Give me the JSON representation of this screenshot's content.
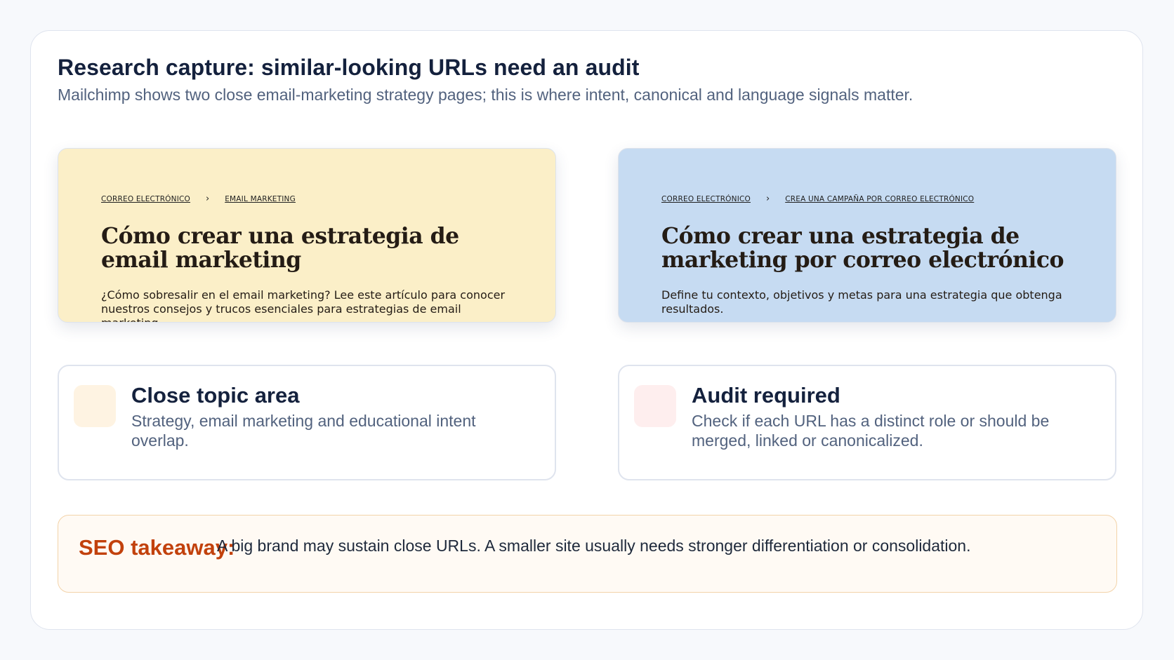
{
  "header": {
    "title": "Research capture: similar-looking URLs need an audit",
    "subtitle": "Mailchimp shows two close email-marketing strategy pages; this is where intent, canonical and language signals matter."
  },
  "screenshots": [
    {
      "crumb_1": "Correo electrónico",
      "separator": "›",
      "crumb_2": "Email marketing",
      "title": "Cómo crear una estrategia de email marketing",
      "description": "¿Cómo sobresalir en el email marketing? Lee este artículo para conocer nuestros consejos y trucos esenciales para estrategias de email marketing",
      "background": "#fbefc8"
    },
    {
      "crumb_1": "Correo electrónico",
      "separator": "›",
      "crumb_2": "Crea una campaña por correo electrónico",
      "title": "Cómo crear una estrategia de marketing por correo electrónico",
      "description": "Define tu contexto, objetivos y metas para una estrategia que obtenga resultados.",
      "background": "#c6dbf2"
    }
  ],
  "cards": [
    {
      "title": "Close topic area",
      "description": "Strategy, email marketing and educational intent overlap.",
      "icon_color": "#fef3e2"
    },
    {
      "title": "Audit required",
      "description": "Check if each URL has a distinct role or should be merged, linked or canonicalized.",
      "icon_color": "#feeeee"
    }
  ],
  "takeaway": {
    "label": "SEO takeaway:",
    "text": "A big brand may sustain close URLs. A smaller site usually needs stronger differentiation or consolidation."
  },
  "colors": {
    "title": "#14213d",
    "muted": "#52627e",
    "accent": "#c2410c"
  }
}
